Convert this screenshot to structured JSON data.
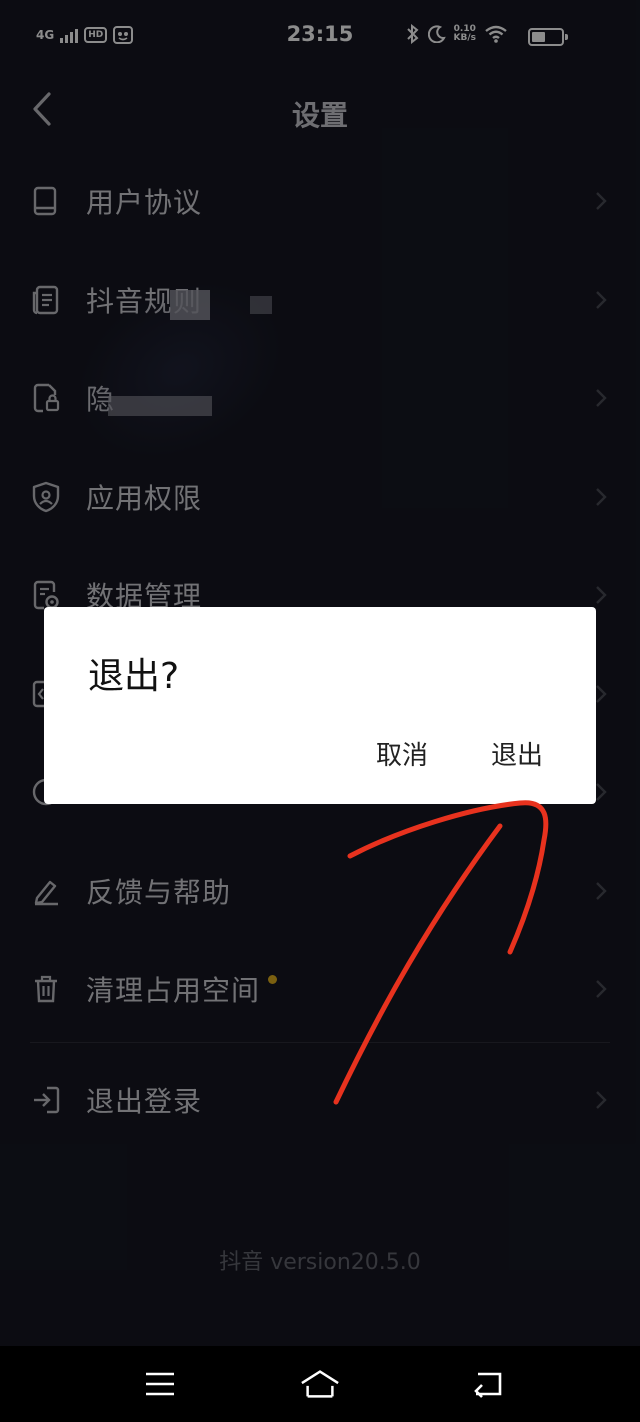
{
  "status_bar": {
    "network": "4G",
    "hd_badge": "HD",
    "time": "23:15",
    "speed_value": "0.10",
    "speed_unit": "KB/s"
  },
  "header": {
    "title": "设置"
  },
  "menu": {
    "items": [
      {
        "label": "用户协议",
        "icon": "book-icon"
      },
      {
        "label": "抖音规则",
        "icon": "document-list-icon"
      },
      {
        "label": "隐",
        "icon": "lock-file-icon"
      },
      {
        "label": "应用权限",
        "icon": "shield-icon"
      },
      {
        "label": "数据管理",
        "icon": "data-settings-icon"
      },
      {
        "label": "",
        "icon": "code-icon"
      },
      {
        "label": "",
        "icon": "circle-icon"
      },
      {
        "label": "反馈与帮助",
        "icon": "pencil-icon"
      },
      {
        "label": "清理占用空间",
        "icon": "trash-icon"
      }
    ],
    "logout_label": "退出登录"
  },
  "version_text": "抖音 version20.5.0",
  "dialog": {
    "title": "退出?",
    "cancel_label": "取消",
    "confirm_label": "退出"
  },
  "colors": {
    "background": "#161722",
    "dialog_bg": "#ffffff",
    "annotation": "#e8321e",
    "badge_dot": "#e0b01e"
  }
}
